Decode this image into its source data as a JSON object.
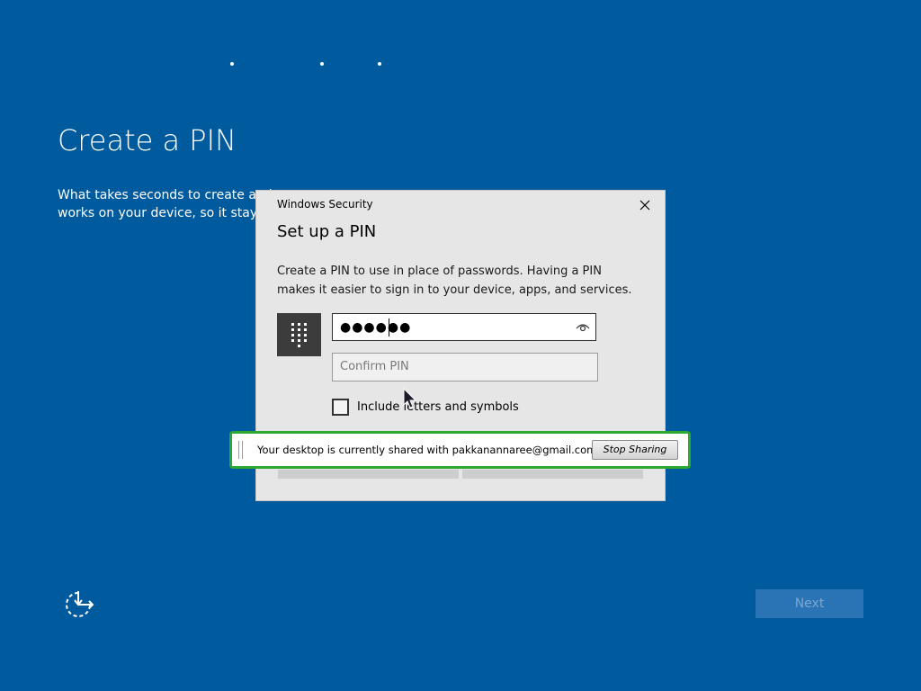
{
  "background_color": "#005a9e",
  "progress_dots": 3,
  "page": {
    "title": "Create a PIN",
    "description_line1": "What takes seconds to create and",
    "description_line2": "works on your device, so it stays c"
  },
  "dialog": {
    "caption": "Windows Security",
    "close_label": "✕",
    "heading": "Set up a PIN",
    "description_line1": "Create a PIN to use in place of passwords. Having a PIN",
    "description_line2": "makes it easier to sign in to your device, apps, and services.",
    "pin_masked_value": "●●●●●●",
    "confirm_placeholder": "Confirm PIN",
    "checkbox_label": "Include letters and symbols",
    "checkbox_checked": false,
    "icons": {
      "keypad": "keypad-icon",
      "reveal": "eye-icon"
    }
  },
  "sharing_banner": {
    "message": "Your desktop is currently shared with pakkanannaree@gmail.com",
    "stop_button": "Stop Sharing",
    "border_color": "#2fa82f"
  },
  "footer": {
    "ease_of_access_icon": "ease-of-access-icon",
    "next_label": "Next"
  }
}
